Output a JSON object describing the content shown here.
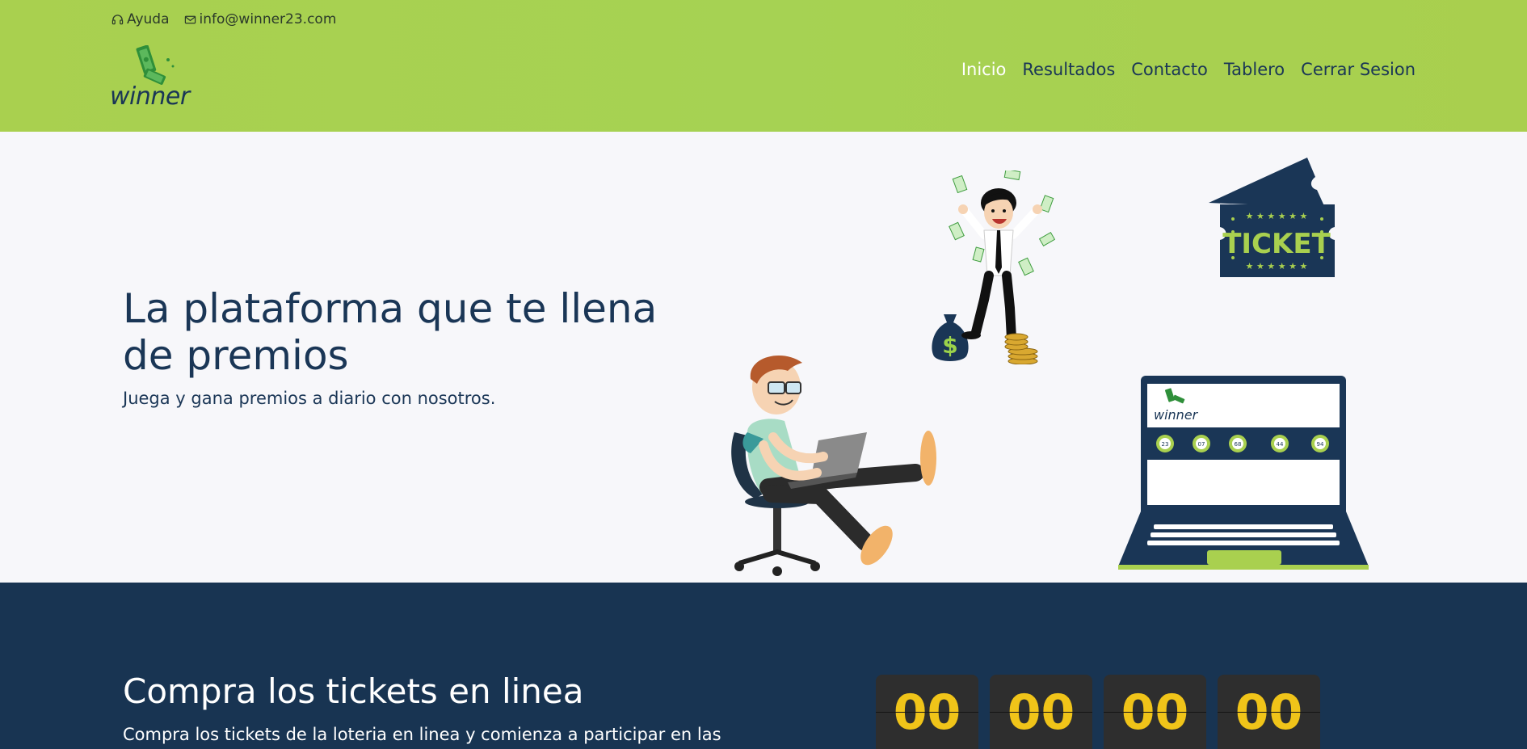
{
  "topbar": {
    "help_label": "Ayuda",
    "email": "info@winner23.com",
    "help_icon": "headset-icon",
    "email_icon": "mail-icon"
  },
  "logo": {
    "text": "winner",
    "ticket_text": "TICKET"
  },
  "nav": {
    "items": [
      {
        "label": "Inicio",
        "active": true
      },
      {
        "label": "Resultados",
        "active": false
      },
      {
        "label": "Contacto",
        "active": false
      },
      {
        "label": "Tablero",
        "active": false
      },
      {
        "label": "Cerrar Sesion",
        "active": false
      }
    ]
  },
  "hero": {
    "title": "La plataforma que te llena de premios",
    "subtitle": "Juega y gana premios a diario con nosotros.",
    "ticket_label": "TICKET",
    "laptop_brand": "winner",
    "balls": [
      "23",
      "07",
      "68",
      "44",
      "94"
    ]
  },
  "section": {
    "title": "Compra los tickets en linea",
    "subtitle": "Compra los tickets de la loteria en linea y comienza a participar en las",
    "countdown": [
      "00",
      "00",
      "00",
      "00"
    ]
  },
  "colors": {
    "header_green": "#a9d04f",
    "navy": "#1a3656",
    "dark_section": "#183452",
    "counter_digit": "#f0c419"
  }
}
